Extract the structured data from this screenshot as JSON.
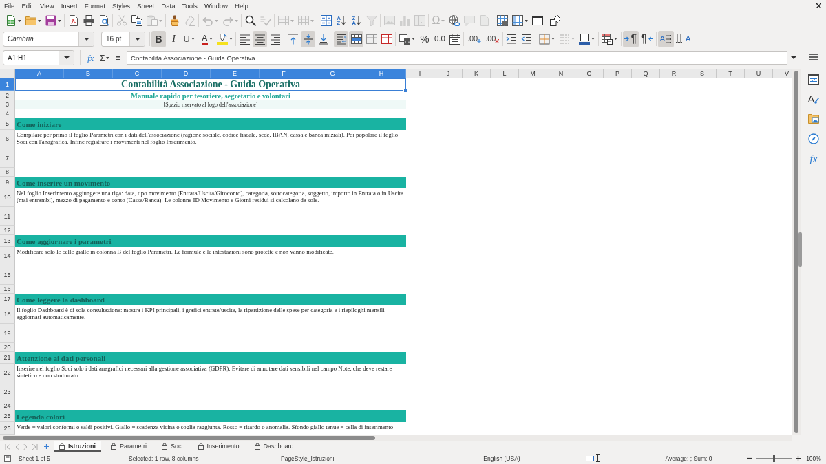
{
  "menu_bar": {
    "items": [
      "File",
      "Edit",
      "View",
      "Insert",
      "Format",
      "Styles",
      "Sheet",
      "Data",
      "Tools",
      "Window",
      "Help"
    ]
  },
  "standard_toolbar": [
    {
      "disabled": false
    },
    {
      "disabled": false
    },
    {
      "disabled": false
    },
    {
      "disabled": false
    },
    {
      "disabled": false
    },
    {
      "disabled": false
    },
    {
      "disabled": true
    },
    {
      "disabled": false
    },
    {
      "disabled": true
    },
    {
      "disabled": false
    },
    {
      "disabled": true
    },
    {
      "disabled": true
    },
    {
      "disabled": true
    },
    {
      "disabled": false
    },
    {
      "disabled": true
    },
    {
      "disabled": true
    },
    {
      "disabled": true
    },
    {
      "disabled": false
    },
    {
      "glyph": "AZ",
      "disabled": false
    },
    {
      "glyph": "ZA",
      "disabled": false
    },
    {
      "disabled": true
    },
    {
      "disabled": true
    },
    {
      "disabled": true
    },
    {
      "disabled": true
    },
    {
      "glyph": "Ω",
      "disabled": true
    },
    {
      "disabled": false
    },
    {
      "disabled": true
    },
    {
      "disabled": true
    },
    {
      "disabled": false
    },
    {
      "disabled": false
    },
    {
      "disabled": false
    },
    {
      "disabled": false
    }
  ],
  "formatting_toolbar": {
    "font_name": {
      "value": "Cambria"
    },
    "font_size": {
      "value": "16 pt"
    },
    "buttons": [
      {
        "glyph": "B",
        "on": true,
        "disabled": false
      },
      {
        "glyph": "I",
        "on": false,
        "disabled": false
      },
      {
        "glyph": "U",
        "on": false,
        "disabled": false
      },
      {
        "glyph": "A",
        "on": false,
        "disabled": false
      },
      {
        "on": false,
        "disabled": false
      },
      {
        "on": false,
        "disabled": false
      },
      {
        "on": true,
        "disabled": false
      },
      {
        "on": false,
        "disabled": false
      },
      {
        "on": false,
        "disabled": false
      },
      {
        "on": true,
        "disabled": false
      },
      {
        "on": false,
        "disabled": false
      },
      {
        "on": true,
        "disabled": false
      },
      {
        "on": true,
        "disabled": false
      },
      {
        "on": false,
        "disabled": false
      },
      {
        "on": false,
        "disabled": false
      },
      {
        "on": false,
        "disabled": false
      },
      {
        "glyph": "%",
        "on": false,
        "disabled": false
      },
      {
        "glyph": "0.0",
        "on": false,
        "disabled": false
      },
      {
        "on": false,
        "disabled": false
      },
      {
        "glyph": ".00",
        "on": false,
        "disabled": false
      },
      {
        "glyph": ".00",
        "on": false,
        "disabled": false
      },
      {
        "on": false,
        "disabled": false
      },
      {
        "on": false,
        "disabled": false
      },
      {
        "on": false,
        "disabled": false
      },
      {
        "on": false,
        "disabled": true
      },
      {
        "on": false,
        "disabled": false
      },
      {
        "on": false,
        "disabled": false
      },
      {
        "glyph": "¶",
        "on": true,
        "disabled": false
      },
      {
        "glyph": "¶",
        "on": false,
        "disabled": false
      },
      {
        "glyph": "A",
        "on": true,
        "disabled": false
      },
      {
        "glyph": "A",
        "on": false,
        "disabled": false
      }
    ]
  },
  "formula_bar": {
    "name_box": {
      "value": "A1:H1"
    },
    "function_wizard": {
      "glyph": "fx"
    },
    "sum": {
      "glyph": "Σ"
    },
    "formula": {
      "glyph": "="
    },
    "input": {
      "value": "Contabilità Associazione - Guida Operativa"
    }
  },
  "sidebar": {
    "styles_tab": {
      "glyph": "A"
    },
    "functions_tab": {
      "glyph": "fx"
    }
  },
  "sheet": {
    "columns": [
      {
        "label": "A",
        "selected": true
      },
      {
        "label": "B",
        "selected": true
      },
      {
        "label": "C",
        "selected": true
      },
      {
        "label": "D",
        "selected": true
      },
      {
        "label": "E",
        "selected": true
      },
      {
        "label": "F",
        "selected": true
      },
      {
        "label": "G",
        "selected": true
      },
      {
        "label": "H",
        "selected": true
      },
      {
        "label": "I",
        "selected": false
      },
      {
        "label": "J",
        "selected": false
      },
      {
        "label": "K",
        "selected": false
      },
      {
        "label": "L",
        "selected": false
      },
      {
        "label": "M",
        "selected": false
      },
      {
        "label": "N",
        "selected": false
      },
      {
        "label": "O",
        "selected": false
      },
      {
        "label": "P",
        "selected": false
      },
      {
        "label": "Q",
        "selected": false
      },
      {
        "label": "R",
        "selected": false
      },
      {
        "label": "S",
        "selected": false
      },
      {
        "label": "T",
        "selected": false
      },
      {
        "label": "U",
        "selected": false
      },
      {
        "label": "V",
        "selected": false
      }
    ],
    "rows": [
      {
        "label": "1",
        "selected": true,
        "kind": "title",
        "text": "Contabilità Associazione - Guida Operativa"
      },
      {
        "label": "2",
        "selected": false,
        "kind": "subtitle",
        "text": "Manuale rapido per tesoriere, segretario e volontari"
      },
      {
        "label": "3",
        "selected": false,
        "kind": "note",
        "text": "[Spazio riservato al logo dell'associazione]"
      },
      {
        "label": "4",
        "selected": false,
        "kind": "blank"
      },
      {
        "label": "5",
        "selected": false,
        "kind": "section",
        "text": "Come iniziare"
      },
      {
        "label": "6",
        "selected": false,
        "kind": "body",
        "text": "Compilare per primo il foglio Parametri con i dati dell'associazione (ragione sociale, codice fiscale, sede, IBAN, cassa e banca iniziali). Poi popolare il foglio Soci con l'anagrafica. Infine registrare i movimenti nel foglio Inserimento."
      },
      {
        "label": "7",
        "selected": false,
        "kind": "spacer"
      },
      {
        "label": "8",
        "selected": false,
        "kind": "blank"
      },
      {
        "label": "9",
        "selected": false,
        "kind": "section",
        "text": "Come inserire un movimento"
      },
      {
        "label": "10",
        "selected": false,
        "kind": "body",
        "text": "Nel foglio Inserimento aggiungere una riga: data, tipo movimento (Entrata/Uscita/Giroconto), categoria, sottocategoria, soggetto, importo in Entrata o in Uscita (mai entrambi), mezzo di pagamento e conto (Cassa/Banca). Le colonne ID Movimento e Giorni residui si calcolano da sole."
      },
      {
        "label": "11",
        "selected": false,
        "kind": "spacer"
      },
      {
        "label": "12",
        "selected": false,
        "kind": "blank"
      },
      {
        "label": "13",
        "selected": false,
        "kind": "section",
        "text": "Come aggiornare i parametri"
      },
      {
        "label": "14",
        "selected": false,
        "kind": "body",
        "text": "Modificare solo le celle gialle in colonna B del foglio Parametri. Le formule e le intestazioni sono protette e non vanno modificate."
      },
      {
        "label": "15",
        "selected": false,
        "kind": "spacer"
      },
      {
        "label": "16",
        "selected": false,
        "kind": "blank"
      },
      {
        "label": "17",
        "selected": false,
        "kind": "section",
        "text": "Come leggere la dashboard"
      },
      {
        "label": "18",
        "selected": false,
        "kind": "body",
        "text": "Il foglio Dashboard è di sola consultazione: mostra i KPI principali, i grafici entrate/uscite, la ripartizione delle spese per categoria e i riepiloghi mensili aggiornati automaticamente."
      },
      {
        "label": "19",
        "selected": false,
        "kind": "spacer"
      },
      {
        "label": "20",
        "selected": false,
        "kind": "blank"
      },
      {
        "label": "21",
        "selected": false,
        "kind": "section",
        "text": "Attenzione ai dati personali"
      },
      {
        "label": "22",
        "selected": false,
        "kind": "body",
        "text": "Inserire nel foglio Soci solo i dati anagrafici necessari alla gestione associativa (GDPR). Evitare di annotare dati sensibili nel campo Note, che deve restare sintetico e non strutturato."
      },
      {
        "label": "23",
        "selected": false,
        "kind": "spacer"
      },
      {
        "label": "24",
        "selected": false,
        "kind": "blank"
      },
      {
        "label": "25",
        "selected": false,
        "kind": "section",
        "text": "Legenda colori"
      },
      {
        "label": "26",
        "selected": false,
        "kind": "body",
        "text": "Verde = valori conformi o saldi positivi. Giallo = scadenza vicina o soglia raggiunta. Rosso = ritardo o anomalia. Sfondo giallo tenue = cella di inserimento"
      }
    ]
  },
  "sheet_tabs": [
    {
      "label": "Istruzioni",
      "selected": true,
      "protected": true
    },
    {
      "label": "Parametri",
      "selected": false,
      "protected": true
    },
    {
      "label": "Soci",
      "selected": false,
      "protected": true
    },
    {
      "label": "Inserimento",
      "selected": false,
      "protected": true
    },
    {
      "label": "Dashboard",
      "selected": false,
      "protected": true
    }
  ],
  "status_bar": {
    "sheet": "Sheet 1 of 5",
    "selection": "Selected: 1 row, 8 columns",
    "page_style": "PageStyle_Istruzioni",
    "language": "English (USA)",
    "summary": "Average: ; Sum: 0",
    "zoom": {
      "level": 0.5,
      "reading": "100%"
    }
  }
}
